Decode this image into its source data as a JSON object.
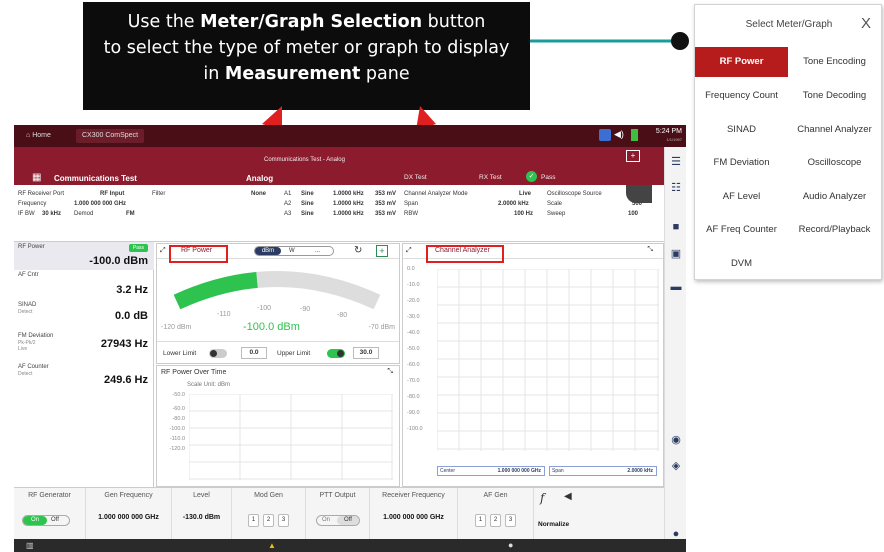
{
  "callout": {
    "line1_a": "Use the ",
    "line1_b": "Meter/Graph Selection",
    "line1_c": " button",
    "line2": "to select the type of meter or graph to display",
    "line3_a": "in ",
    "line3_b": "Measurement",
    "line3_c": " pane"
  },
  "menu": {
    "title": "Select Meter/Graph",
    "close": "X",
    "items": [
      "RF Power",
      "Tone Encoding",
      "Frequency Count",
      "Tone Decoding",
      "SINAD",
      "Channel Analyzer",
      "FM Deviation",
      "Oscilloscope",
      "AF Level",
      "Audio Analyzer",
      "AF Freq Counter",
      "Record/Playback",
      "DVM"
    ]
  },
  "topbar": {
    "home": "Home",
    "device": "CX300 ComSpect",
    "time": "5:24 PM",
    "date": "1/1/1997"
  },
  "bar2": {
    "title": "Communications Test - Analog",
    "mode": "Communications Test",
    "sub": "Analog",
    "tx": "DX Test",
    "rx": "RX Test",
    "pass": "Pass"
  },
  "info": {
    "rf_port_label": "RF Receiver Port",
    "rf_port": "RF Input",
    "freq_label": "Frequency",
    "freq": "1.000 000 000 GHz",
    "ifbw_label": "IF BW",
    "ifbw": "30 kHz",
    "demod_label": "Demod",
    "demod": "FM",
    "filter_label": "Filter",
    "filter": "None",
    "a1": "A1",
    "a2": "A2",
    "a3": "A3",
    "sine": "Sine",
    "tone_freq": "1.0000 kHz",
    "tone_lvl": "353 mV",
    "ca_mode_label": "Channel Analyzer Mode",
    "ca_mode": "Live",
    "span_label": "Span",
    "span": "2.0000 kHz",
    "rbw_label": "RBW",
    "rbw": "100 Hz",
    "osc_label": "Oscilloscope Source",
    "scale_label": "Scale",
    "scale": "500",
    "sweep_label": "Sweep",
    "sweep": "100"
  },
  "left": {
    "rfpower_label": "RF Power",
    "rfpower_badge": "Pass",
    "rfpower": "-100.0 dBm",
    "af_label": "AF Cntr",
    "af": "3.2 Hz",
    "sinad_label": "SINAD",
    "sinad_sub": "Detect",
    "sinad": "0.0 dB",
    "fmdev_label": "FM Deviation",
    "fmdev_sub": "Pk-Pk/2",
    "fmdev_sub2": "Live",
    "fmdev": "27943 Hz",
    "afc_label": "AF Counter",
    "afc_sub": "Detect",
    "afc": "249.6 Hz"
  },
  "meter": {
    "title": "RF Power",
    "unit_a": "dBm",
    "unit_b": "W",
    "dots": "...",
    "scale": [
      "-110",
      "-100",
      "-90",
      "-80"
    ],
    "min": "-120 dBm",
    "max": "-70 dBm",
    "value": "-100.0 dBm",
    "value_fraction": 0.4,
    "lower_label": "Lower Limit",
    "lower": "0.0",
    "upper_label": "Upper Limit",
    "upper": "30.0"
  },
  "pot": {
    "title": "RF Power Over Time",
    "unit": "Scale Unit: dBm",
    "ticks": [
      "-50.0",
      "-60.0",
      "-80.0",
      "-100.0",
      "-110.0",
      "-120.0"
    ]
  },
  "ca": {
    "title": "Channel Analyzer",
    "ticks": [
      "0.0",
      "-10.0",
      "-20.0",
      "-30.0",
      "-40.0",
      "-50.0",
      "-60.0",
      "-70.0",
      "-80.0",
      "-90.0",
      "-100.0"
    ],
    "center_label": "Center",
    "center": "1.000 000 000 GHz",
    "span_label": "Span",
    "span": "2.0000 kHz"
  },
  "bottom": {
    "rfgen": "RF Generator",
    "on": "On",
    "off": "Off",
    "genfreq": "Gen Frequency",
    "genfreq_val": "1.000 000 000 GHz",
    "level": "Level",
    "level_val": "-130.0 dBm",
    "modgen": "Mod Gen",
    "n1": "1",
    "n2": "2",
    "n3": "3",
    "ptt": "PTT Output",
    "rxfreq": "Receiver Frequency",
    "rxfreq_val": "1.000 000 000 GHz",
    "afgen": "AF Gen",
    "normalize": "Normalize"
  }
}
